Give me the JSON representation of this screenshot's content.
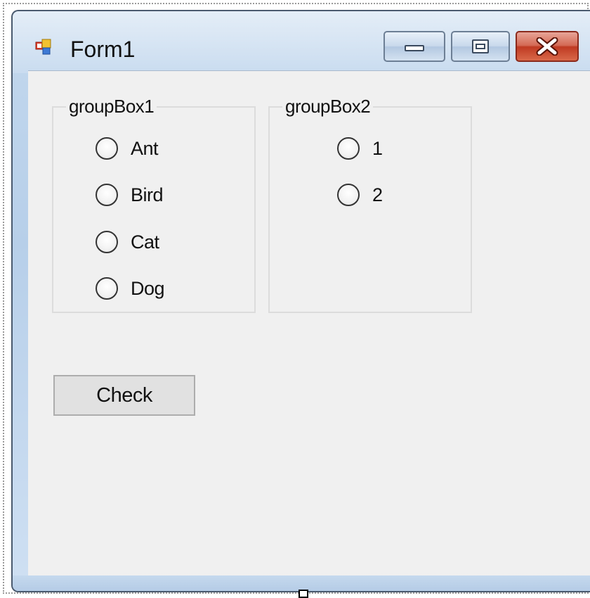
{
  "window": {
    "title": "Form1",
    "icon": "form-window-icon",
    "caption_buttons": [
      "minimize-icon",
      "maximize-icon",
      "close-icon"
    ]
  },
  "group_box_1": {
    "title": "groupBox1",
    "options": [
      "Ant",
      "Bird",
      "Cat",
      "Dog"
    ]
  },
  "group_box_2": {
    "title": "groupBox2",
    "options": [
      "1",
      "2"
    ]
  },
  "check_button": {
    "label": "Check"
  },
  "colors": {
    "client_background": "#f0f0f0",
    "titlebar": "#c3d8ee",
    "close_button": "#c9412a"
  }
}
